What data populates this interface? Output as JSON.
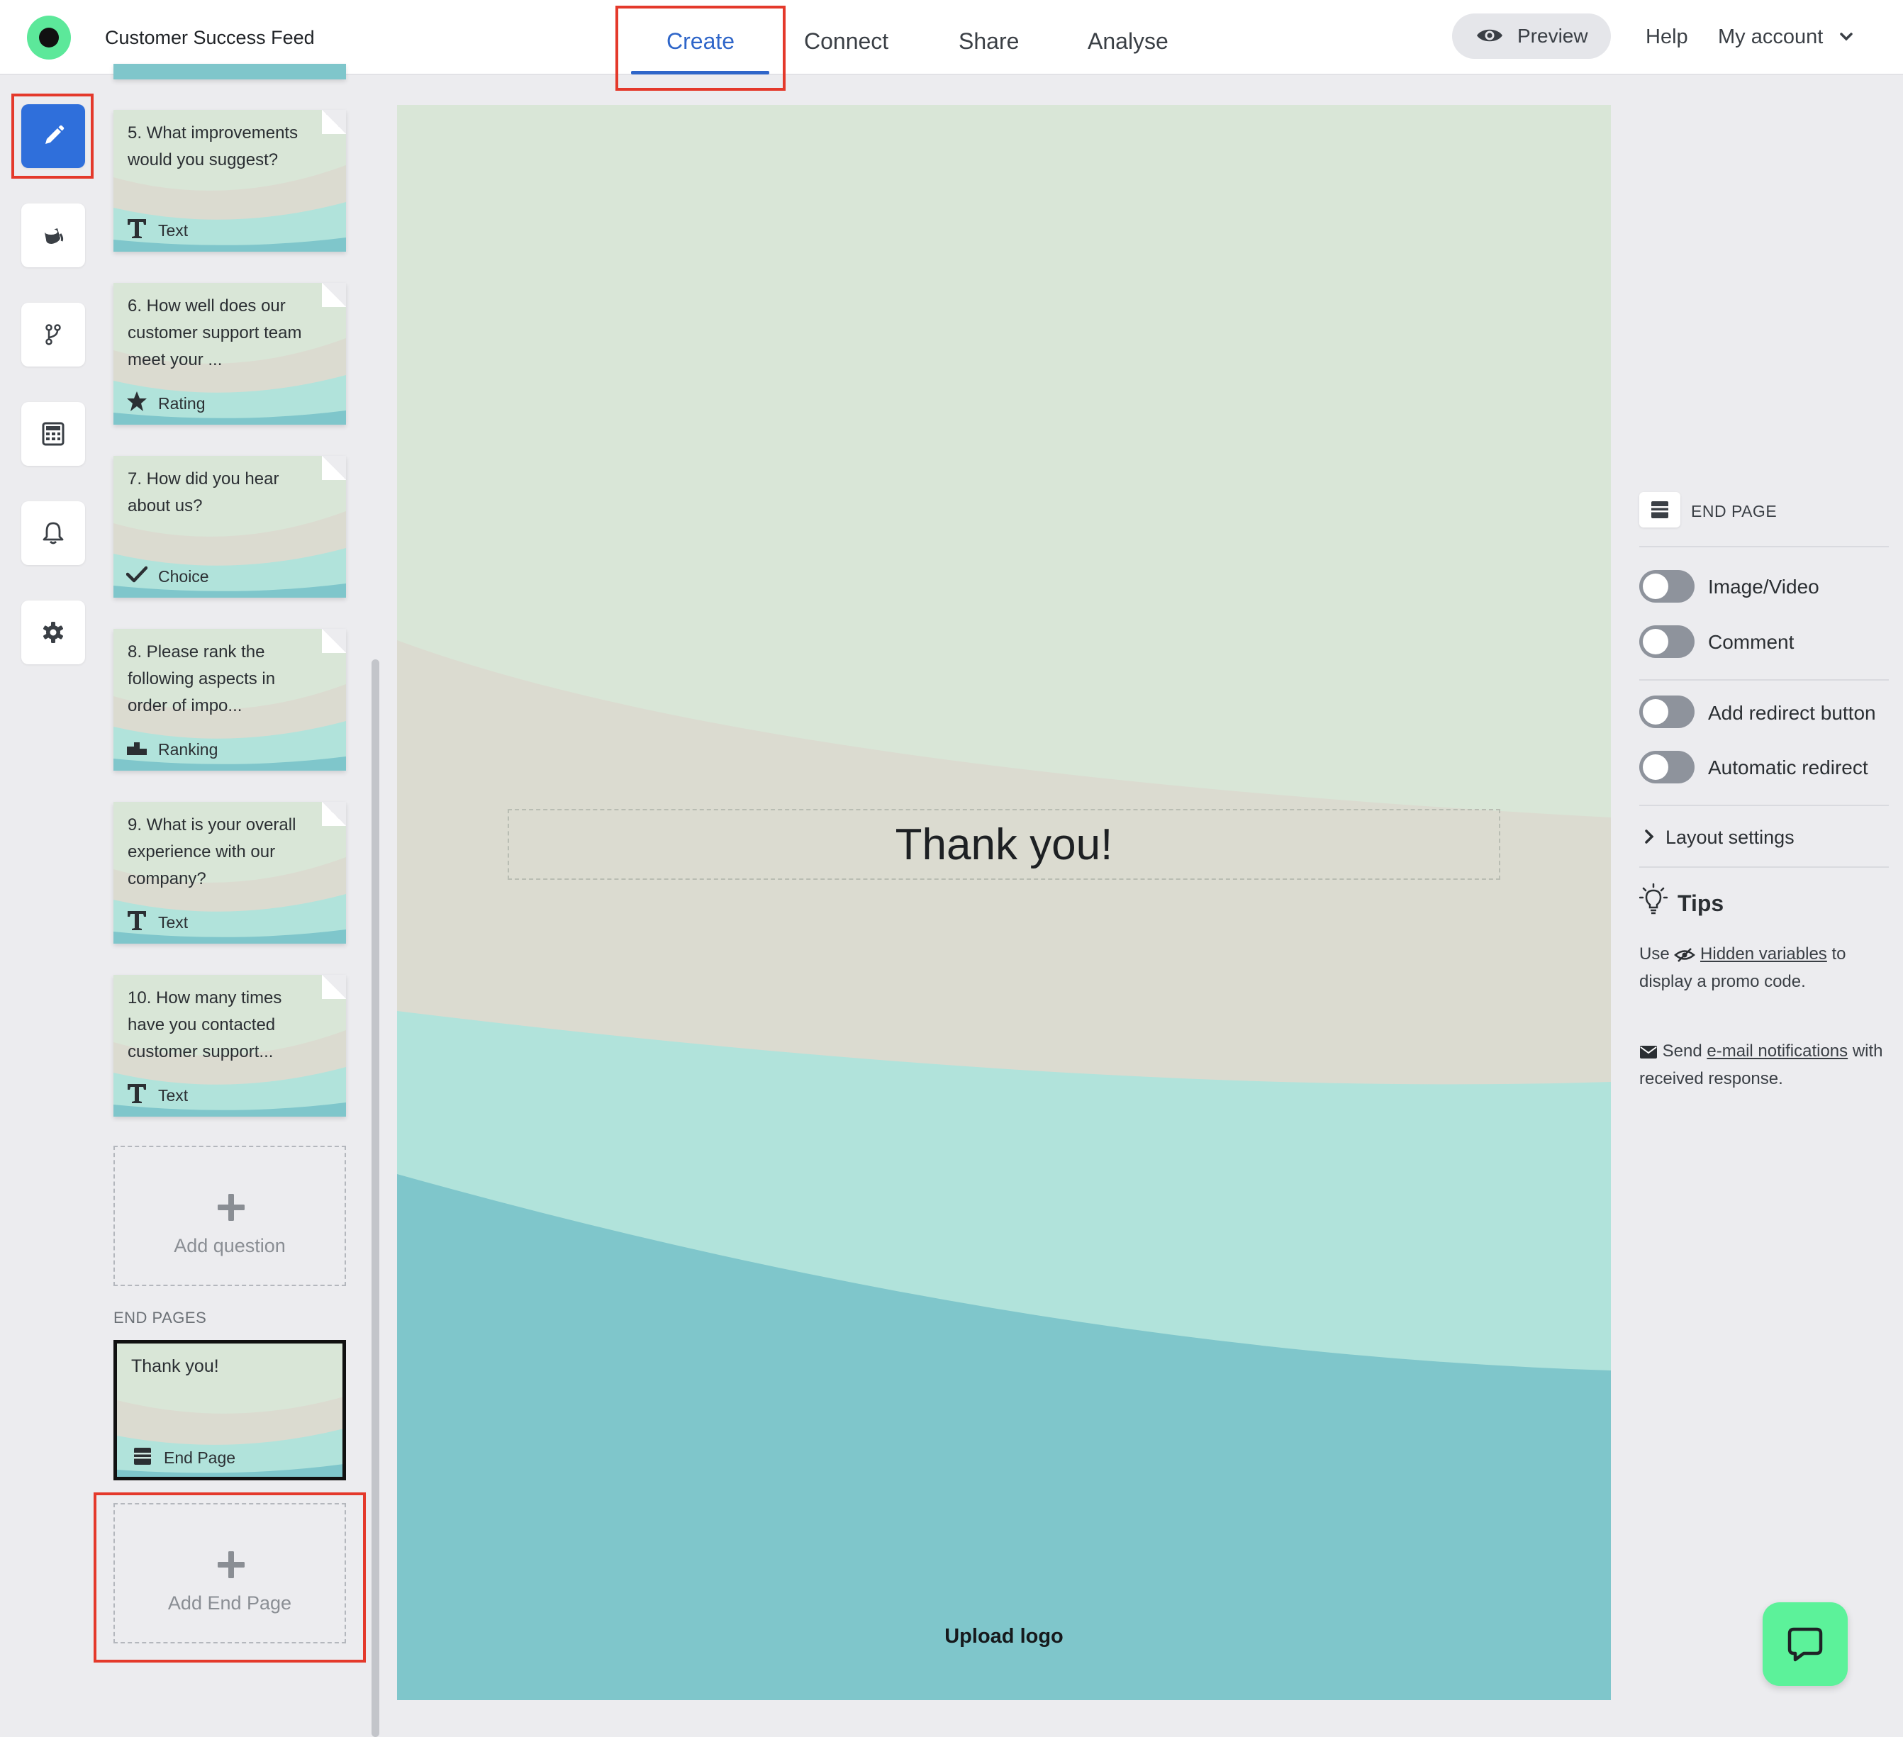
{
  "header": {
    "survey_title": "Customer Success Feed",
    "tabs": [
      {
        "label": "Create",
        "active": true
      },
      {
        "label": "Connect",
        "active": false
      },
      {
        "label": "Share",
        "active": false
      },
      {
        "label": "Analyse",
        "active": false
      }
    ],
    "preview_label": "Preview",
    "help_label": "Help",
    "account_label": "My account"
  },
  "rail": {
    "items": [
      {
        "icon": "pencil-icon",
        "active": true
      },
      {
        "icon": "paint-bucket-icon",
        "active": false
      },
      {
        "icon": "branch-icon",
        "active": false
      },
      {
        "icon": "calculator-icon",
        "active": false
      },
      {
        "icon": "bell-icon",
        "active": false
      },
      {
        "icon": "gear-icon",
        "active": false
      }
    ]
  },
  "questions": [
    {
      "text": "5. What improvements would you suggest?",
      "type": "Text",
      "icon": "text-type-icon"
    },
    {
      "text": "6. How well does our customer support team meet your ...",
      "type": "Rating",
      "icon": "star-icon"
    },
    {
      "text": "7. How did you hear about us?",
      "type": "Choice",
      "icon": "check-icon"
    },
    {
      "text": "8. Please rank the following aspects in order of impo...",
      "type": "Ranking",
      "icon": "ranking-icon"
    },
    {
      "text": "9. What is your overall experience with our company?",
      "type": "Text",
      "icon": "text-type-icon"
    },
    {
      "text": "10. How many times have you contacted customer support...",
      "type": "Text",
      "icon": "text-type-icon"
    }
  ],
  "add_question_label": "Add question",
  "end_pages": {
    "section_label": "END PAGES",
    "items": [
      {
        "text": "Thank you!",
        "type": "End Page",
        "selected": true
      }
    ],
    "add_label": "Add End Page"
  },
  "canvas": {
    "heading": "Thank you!",
    "upload_logo_label": "Upload logo"
  },
  "settings": {
    "section_label": "END PAGE",
    "toggles": [
      {
        "label": "Image/Video",
        "on": false
      },
      {
        "label": "Comment",
        "on": false
      },
      {
        "label": "Add redirect button",
        "on": false
      },
      {
        "label": "Automatic redirect",
        "on": false
      }
    ],
    "layout_label": "Layout settings",
    "tips": {
      "title": "Tips",
      "tip1_prefix": "Use",
      "tip1_link": "Hidden variables",
      "tip1_suffix": "to display a promo code.",
      "tip2_prefix": "Send",
      "tip2_link": "e-mail notifications",
      "tip2_suffix": "with received response."
    }
  },
  "colors": {
    "accent": "#2f66c9",
    "rail_active": "#2f6fdb",
    "highlight": "#e4392b",
    "chat_button": "#5cf29a",
    "theme_sage": "#d9e6d7",
    "theme_taupe": "#dbdbd0",
    "theme_mint": "#b1e3db",
    "theme_teal": "#7fc6cb"
  }
}
